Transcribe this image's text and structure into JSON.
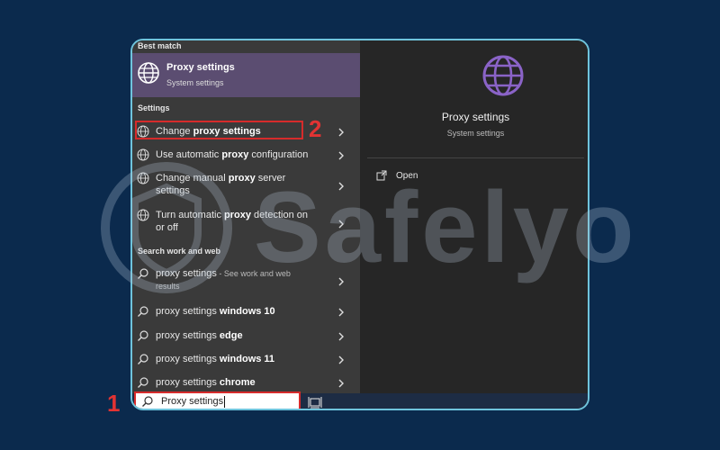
{
  "search": {
    "query": "Proxy settings"
  },
  "sections": {
    "best_match": "Best match",
    "settings": "Settings",
    "search_web": "Search work and web"
  },
  "best_match": {
    "title": "Proxy settings",
    "subtitle": "System settings"
  },
  "settings_items": [
    {
      "pre": "Change ",
      "bold": "proxy settings",
      "post": "",
      "line2": ""
    },
    {
      "pre": "Use automatic ",
      "bold": "proxy",
      "post": " configuration",
      "line2": ""
    },
    {
      "pre": "Change manual ",
      "bold": "proxy",
      "post": " server",
      "line2": "settings"
    },
    {
      "pre": "Turn automatic ",
      "bold": "proxy",
      "post": " detection on",
      "line2": "or off"
    }
  ],
  "web_items": [
    {
      "pre": "proxy settings",
      "bold": "",
      "sub": " - See work and web",
      "line2": "results"
    },
    {
      "pre": "proxy settings ",
      "bold": "windows 10",
      "sub": "",
      "line2": ""
    },
    {
      "pre": "proxy settings ",
      "bold": "edge",
      "sub": "",
      "line2": ""
    },
    {
      "pre": "proxy settings ",
      "bold": "windows 11",
      "sub": "",
      "line2": ""
    },
    {
      "pre": "proxy settings ",
      "bold": "chrome",
      "sub": "",
      "line2": ""
    }
  ],
  "preview": {
    "title": "Proxy settings",
    "subtitle": "System settings",
    "open_label": "Open"
  },
  "annotations": {
    "step1": "1",
    "step2": "2"
  },
  "watermark": "Safelyo",
  "colors": {
    "background": "#0b2a4d",
    "frame_border": "#6fc4dc",
    "highlight": "#5b4d71",
    "annotation_red": "#d62b2b",
    "globe_purple": "#8a63c7"
  }
}
